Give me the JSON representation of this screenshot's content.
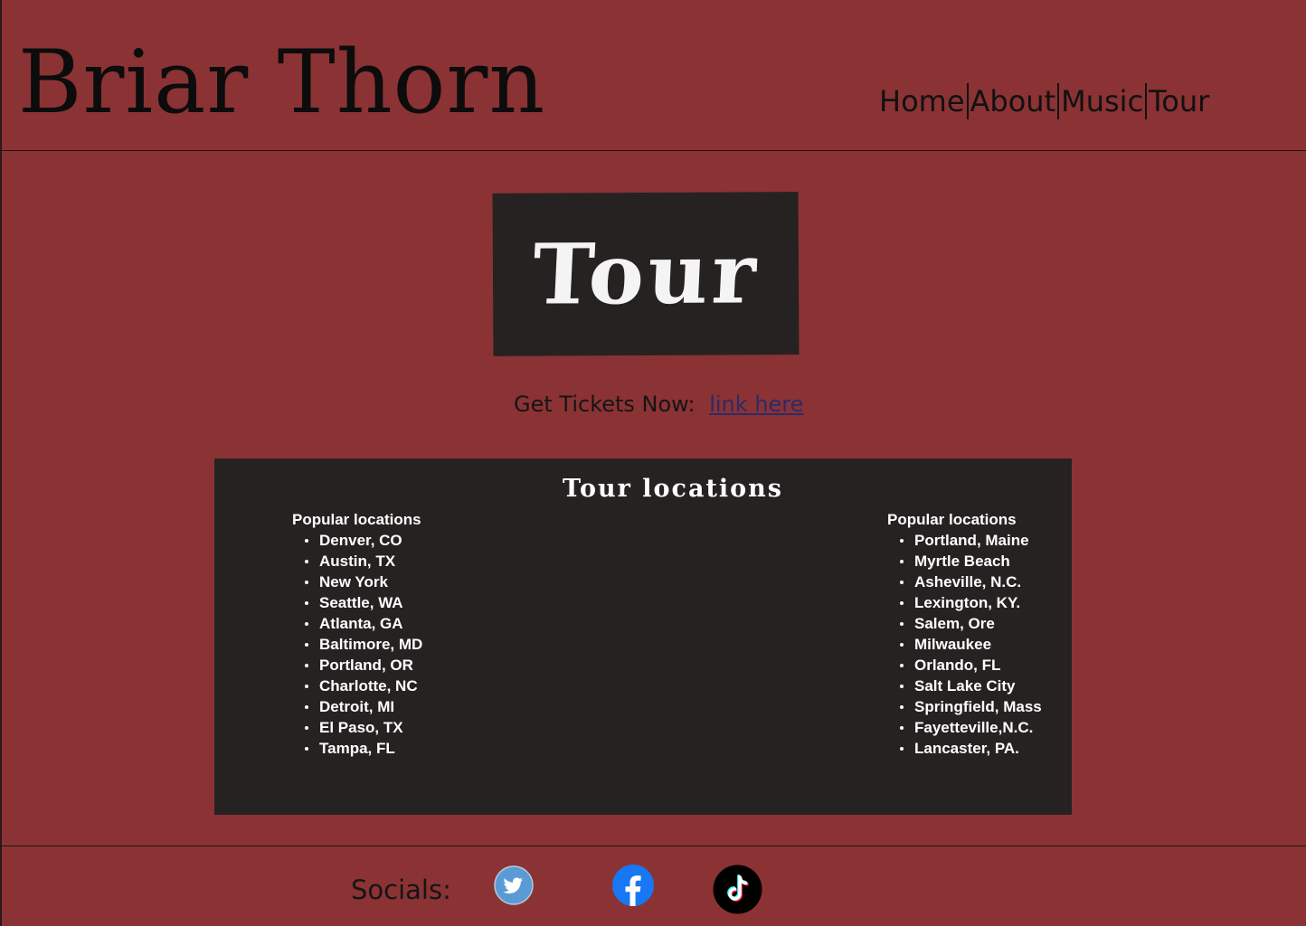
{
  "header": {
    "brand": "Briar Thorn",
    "nav": [
      {
        "label": "Home"
      },
      {
        "label": "About"
      },
      {
        "label": "Music"
      },
      {
        "label": "Tour"
      }
    ]
  },
  "main": {
    "title": "Tour",
    "tickets_label": "Get Tickets Now:",
    "tickets_link": "link here",
    "locations": {
      "heading": "Tour locations",
      "left": {
        "title": "Popular locations",
        "items": [
          "Denver, CO",
          "Austin, TX",
          "New York",
          "Seattle, WA",
          "Atlanta, GA",
          "Baltimore, MD",
          "Portland, OR",
          "Charlotte, NC",
          "Detroit, MI",
          "El Paso, TX",
          "Tampa, FL"
        ]
      },
      "right": {
        "title": "Popular locations",
        "items": [
          "Portland, Maine",
          "Myrtle Beach",
          "Asheville, N.C.",
          "Lexington, KY.",
          "Salem, Ore",
          "Milwaukee",
          "Orlando, FL",
          "Salt Lake City",
          "Springfield, Mass",
          "Fayetteville,N.C.",
          "Lancaster, PA."
        ]
      }
    }
  },
  "footer": {
    "socials_label": "Socials:",
    "icons": [
      "twitter-icon",
      "facebook-icon",
      "tiktok-icon"
    ]
  },
  "colors": {
    "background": "#8b3234",
    "panel": "#262222",
    "link": "#2c2a6a",
    "twitter": "#5b9bd5",
    "facebook": "#1877f2",
    "tiktok": "#000000"
  }
}
